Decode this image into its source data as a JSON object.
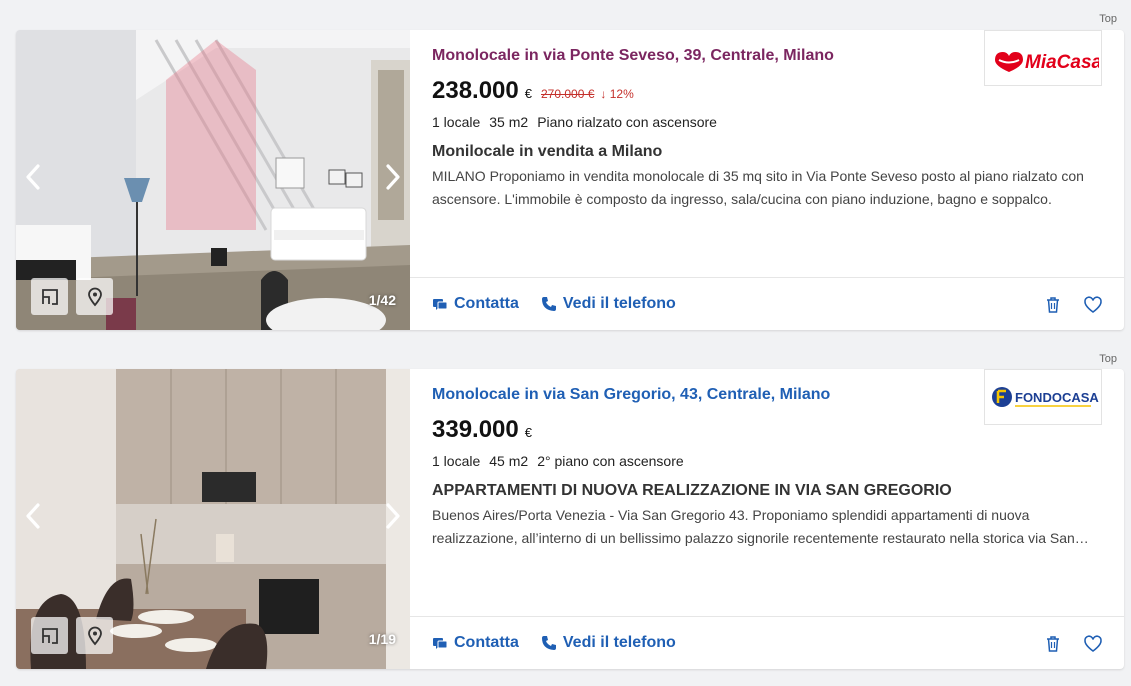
{
  "listings": [
    {
      "badge": "Top",
      "title": "Monolocale in via Ponte Seveso, 39, Centrale, Milano",
      "price": "238.000",
      "currency": "€",
      "old_price": "270.000 €",
      "drop": "↓ 12%",
      "features": [
        "1 locale",
        "35 m2",
        "Piano rialzato con ascensore"
      ],
      "subtitle": "Monilocale in vendita a Milano",
      "description": "MILANO Proponiamo in vendita monolocale di 35 mq sito in Via Ponte Seveso posto al piano rialzato con ascensore. L'immobile è composto da ingresso, sala/cucina con piano induzione, bagno e soppalco.",
      "photo_counter": "1/42",
      "agency": "MiaCasa",
      "contact_label": "Contatta",
      "phone_label": "Vedi il telefono"
    },
    {
      "badge": "Top",
      "title": "Monolocale in via San Gregorio, 43, Centrale, Milano",
      "price": "339.000",
      "currency": "€",
      "features": [
        "1 locale",
        "45 m2",
        "2° piano con ascensore"
      ],
      "subtitle": "APPARTAMENTI DI NUOVA REALIZZAZIONE IN VIA SAN GREGORIO",
      "description": "Buenos Aires/Porta Venezia - Via San Gregorio 43. Proponiamo splendidi appartamenti di nuova realizzazione, all’interno di un bellissimo palazzo signorile recentemente restaurato nella storica via San Gregorio.",
      "photo_counter": "1/19",
      "agency": "FONDOCASA",
      "contact_label": "Contatta",
      "phone_label": "Vedi il telefono"
    }
  ],
  "colors": {
    "link": "#1f5fb4",
    "visited_link": "#7b2660",
    "price_drop": "#c4302b",
    "miacasa_red": "#e2001a",
    "fondocasa_blue": "#1c3f94"
  },
  "icons": [
    "chevron-left-icon",
    "chevron-right-icon",
    "floorplan-icon",
    "map-pin-icon",
    "chat-icon",
    "phone-icon",
    "trash-icon",
    "heart-icon"
  ]
}
